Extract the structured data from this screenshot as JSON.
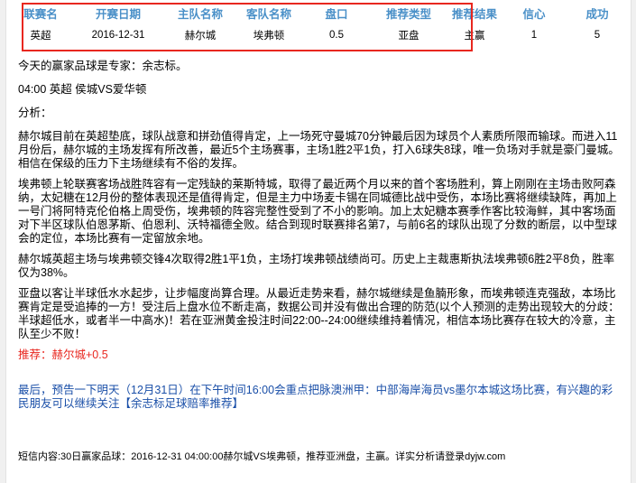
{
  "summary": {
    "headers": [
      "联赛名",
      "开赛日期",
      "主队名称",
      "客队名称",
      "盘口",
      "推荐类型",
      "推荐结果",
      "信心",
      "成功"
    ],
    "row": [
      "英超",
      "2016-12-31",
      "赫尔城",
      "埃弗顿",
      "0.5",
      "亚盘",
      "主赢",
      "1",
      "5"
    ]
  },
  "article": {
    "expert_line": "今天的赢家品球是专家：余志标。",
    "match_line": "04:00 英超 侯城VS爱华顿",
    "analysis_label": "分析：",
    "paragraphs": [
      "赫尔城目前在英超垫底，球队战意和拼劲值得肯定，上一场死守曼城70分钟最后因为球员个人素质所限而输球。而进入11月份后，赫尔城的主场发挥有所改善，最近5个主场赛事，主场1胜2平1负，打入6球失8球，唯一负场对手就是豪门曼城。相信在保级的压力下主场继续有不俗的发挥。",
      "埃弗顿上轮联赛客场战胜阵容有一定残缺的莱斯特城，取得了最近两个月以来的首个客场胜利，算上刚刚在主场击败阿森纳，太妃糖在12月份的整体表现还是值得肯定，但是主力中场麦卡锡在同城德比战中受伤，本场比赛将继续缺阵，再加上一号门将阿特克伦伯格上周受伤，埃弗顿的阵容完整性受到了不小的影响。加上太妃糖本赛季作客比较海鲜，其中客场面对下半区球队伯恩茅斯、伯恩利、沃特福德全败。结合到现时联赛排名第7，与前6名的球队出现了分数的断层，以中型球会的定位，本场比赛有一定留放余地。",
      "赫尔城英超主场与埃弗顿交锋4次取得2胜1平1负，主场打埃弗顿战绩尚可。历史上主裁惠斯执法埃弗顿6胜2平8负，胜率仅为38%。",
      "亚盘以客让半球低水水起步，让步幅度尚算合理。从最近走势来看，赫尔城继续是鱼腩形象，而埃弗顿连克强敌，本场比赛肯定是受追捧的一方！受注后上盘水位不断走高，数据公司并没有做出合理的防范(以个人预测的走势出现较大的分歧：半球超低水，或者半一中高水)！若在亚洲黄金投注时间22:00--24:00继续维持着情况，相信本场比赛存在较大的冷意，主队至少不败！"
    ],
    "recommendation": "推荐：赫尔城+0.5",
    "promo": "最后，预告一下明天（12月31日）在下午时间16:00会重点把脉澳洲甲：中部海岸海员vs墨尔本城这场比赛，有兴趣的彩民朋友可以继续关注【余志标足球赔率推荐】",
    "footer": "短信内容:30日赢家品球：2016-12-31 04:00:00赫尔城VS埃弗顿，推荐亚洲盘，主赢。详实分析请登录dyjw.com"
  },
  "colors": {
    "header_text": "#4a90c8",
    "highlight_border": "#e8271f",
    "recommendation": "#e8271f",
    "promo_text": "#1a4fa8"
  }
}
